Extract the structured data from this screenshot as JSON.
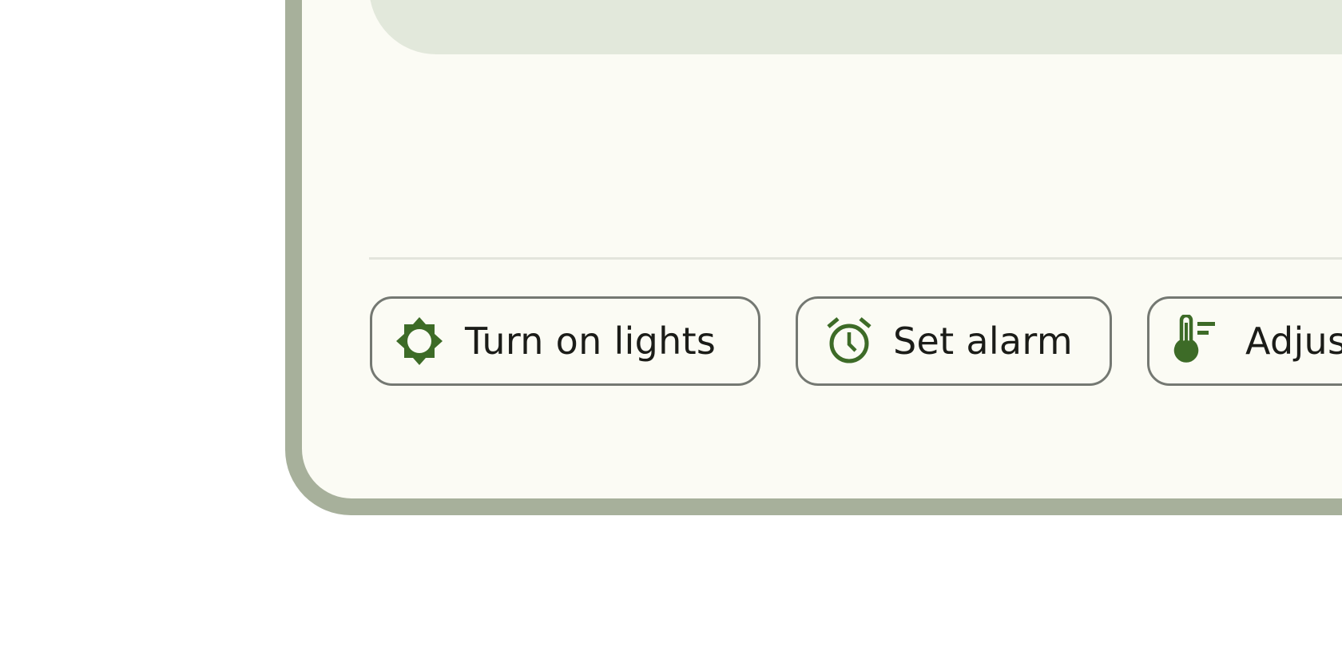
{
  "suggestions": [
    {
      "label": "Turn on lights",
      "icon": "brightness-icon"
    },
    {
      "label": "Set alarm",
      "icon": "alarm-clock-icon"
    },
    {
      "label": "Adjust",
      "icon": "thermostat-icon"
    }
  ],
  "colors": {
    "frame": "#a7b09b",
    "screen_background": "#fbfbf4",
    "top_panel": "#e2e8db",
    "chip_border": "#747872",
    "icon_accent": "#3d6b27",
    "text": "#1b1c18"
  }
}
